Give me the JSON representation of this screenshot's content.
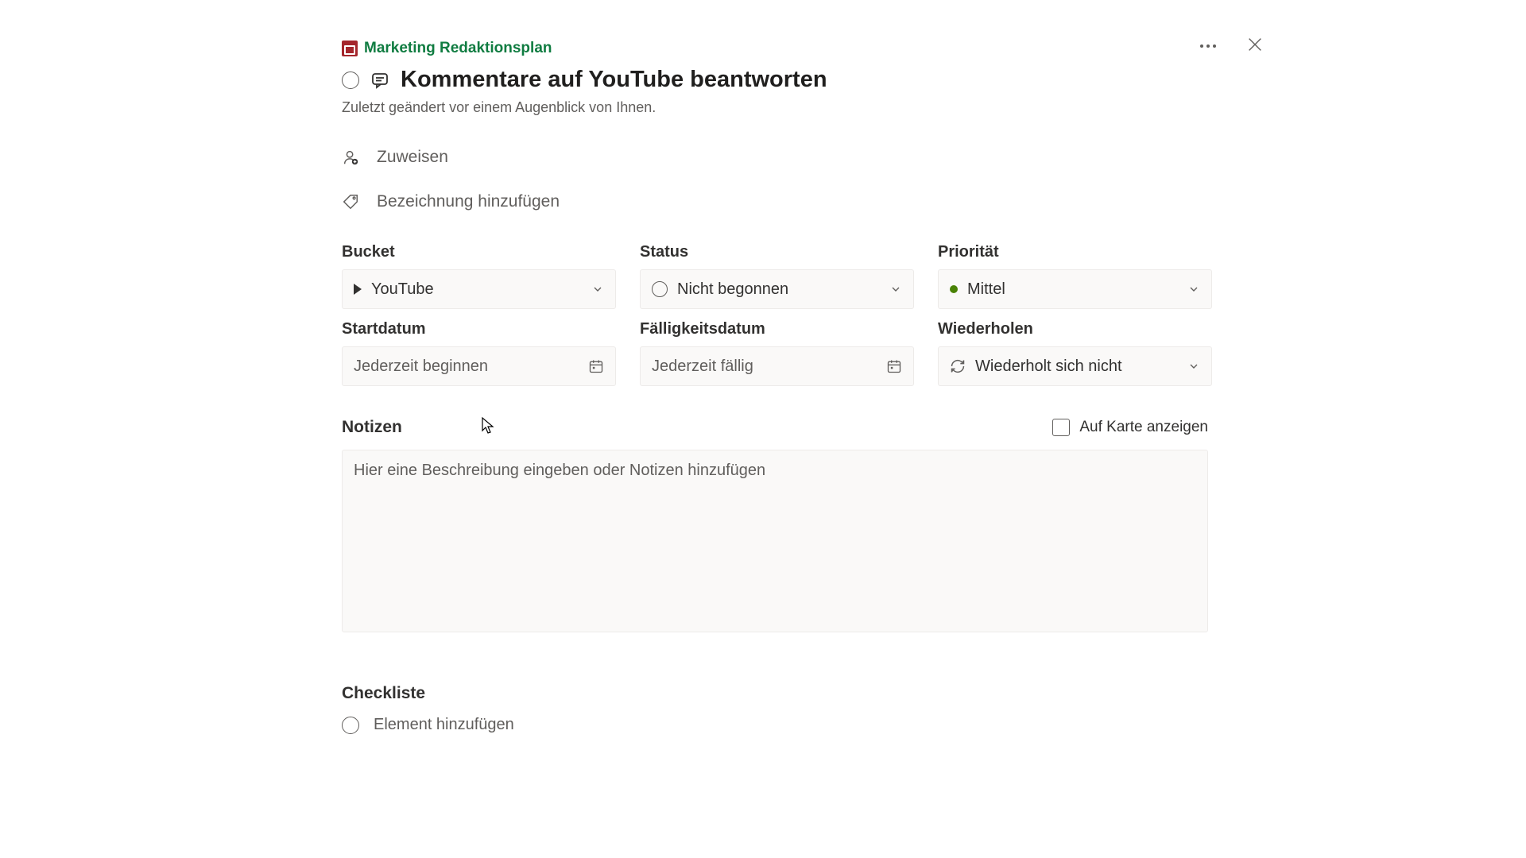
{
  "plan_name": "Marketing Redaktionsplan",
  "task_title": "Kommentare auf YouTube beantworten",
  "meta": "Zuletzt geändert vor einem Augenblick von Ihnen.",
  "assign_label": "Zuweisen",
  "label_label": "Bezeichnung hinzufügen",
  "fields": {
    "bucket_label": "Bucket",
    "bucket_value": "YouTube",
    "status_label": "Status",
    "status_value": "Nicht begonnen",
    "priority_label": "Priorität",
    "priority_value": "Mittel",
    "start_label": "Startdatum",
    "start_placeholder": "Jederzeit beginnen",
    "due_label": "Fälligkeitsdatum",
    "due_placeholder": "Jederzeit fällig",
    "repeat_label": "Wiederholen",
    "repeat_value": "Wiederholt sich nicht"
  },
  "notes": {
    "title": "Notizen",
    "show_on_card": "Auf Karte anzeigen",
    "placeholder": "Hier eine Beschreibung eingeben oder Notizen hinzufügen"
  },
  "checklist": {
    "title": "Checkliste",
    "add_item": "Element hinzufügen"
  }
}
